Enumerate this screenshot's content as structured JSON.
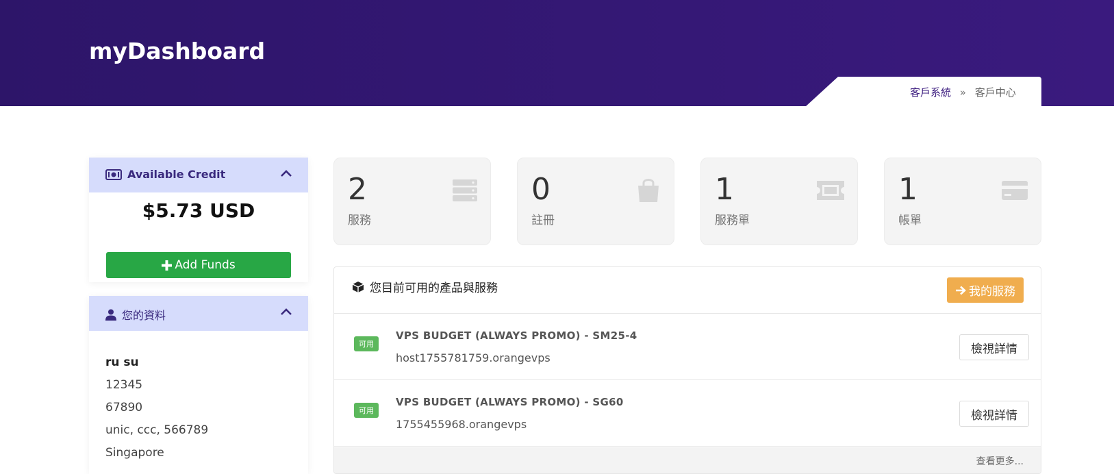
{
  "header": {
    "title": "myDashboard"
  },
  "breadcrumb": {
    "link": "客戶系統",
    "separator": "»",
    "current": "客戶中心"
  },
  "credit_panel": {
    "title": "Available Credit",
    "amount": "$5.73 USD",
    "add_funds_label": "Add Funds",
    "icon": "money-icon"
  },
  "profile_panel": {
    "title": "您的資料",
    "name": "ru su",
    "lines": [
      "12345",
      "67890",
      "unic, ccc, 566789",
      "Singapore"
    ],
    "icon": "user-icon"
  },
  "stats": [
    {
      "value": "2",
      "label": "服務",
      "icon": "server-icon"
    },
    {
      "value": "0",
      "label": "註冊",
      "icon": "shopping-bag-icon"
    },
    {
      "value": "1",
      "label": "服務單",
      "icon": "ticket-icon"
    },
    {
      "value": "1",
      "label": "帳單",
      "icon": "credit-card-icon"
    }
  ],
  "services": {
    "title": "您目前可用的產品與服務",
    "my_services_label": "我的服務",
    "items": [
      {
        "status": "可用",
        "product": "VPS BUDGET (ALWAYS PROMO) - SM25-4",
        "host": "host1755781759.orangevps",
        "action": "檢視詳情"
      },
      {
        "status": "可用",
        "product": "VPS BUDGET (ALWAYS PROMO) - SG60",
        "host": "1755455968.orangevps",
        "action": "檢視詳情"
      }
    ],
    "more_label": "查看更多..."
  },
  "colors": {
    "header": "#2d1569",
    "panel_header": "#d6dcfc",
    "success": "#28a745",
    "warning": "#f0ad4e",
    "badge": "#5cb85c"
  }
}
